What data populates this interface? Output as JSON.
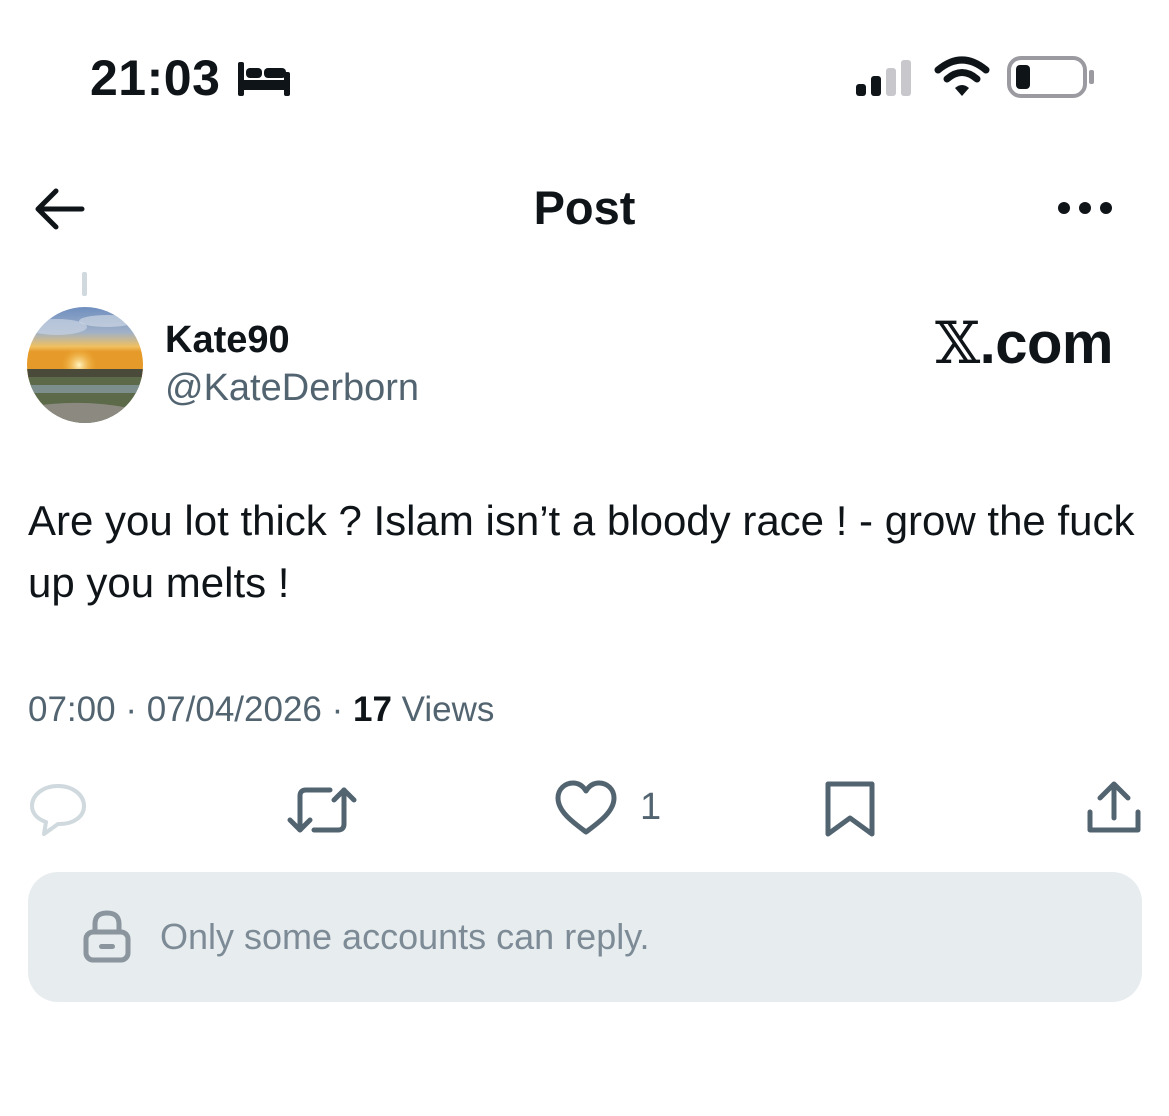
{
  "status_bar": {
    "time": "21:03"
  },
  "header": {
    "title": "Post"
  },
  "post": {
    "display_name": "Kate90",
    "handle": "@KateDerborn",
    "watermark_x": "𝕏",
    "watermark_rest": ".com",
    "text": "Are you lot thick ? Islam isn’t a bloody race ! - grow the fuck up you melts !",
    "time": "07:00",
    "separator": " · ",
    "date": "07/04/2026",
    "views_count": "17",
    "views_label": " Views",
    "likes_count": "1"
  },
  "reply_restriction": {
    "text": "Only some accounts can reply."
  },
  "colors": {
    "text_primary": "#0f1419",
    "text_secondary": "#536471",
    "restriction_bg": "#e7ecef"
  },
  "icons": [
    "bed-icon",
    "signal-icon",
    "wifi-icon",
    "battery-icon",
    "back-arrow-icon",
    "more-icon",
    "reply-icon",
    "retweet-icon",
    "like-icon",
    "bookmark-icon",
    "share-icon",
    "lock-icon"
  ]
}
